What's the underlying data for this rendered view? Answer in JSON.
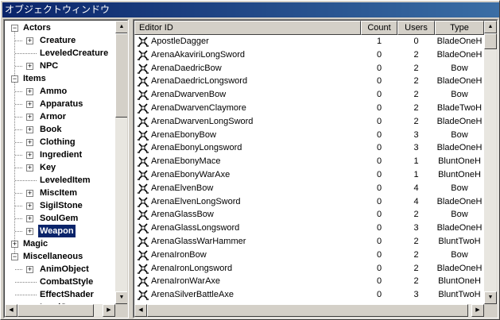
{
  "window": {
    "title": "オブジェクトウィンドウ"
  },
  "tree": {
    "items": [
      {
        "label": "Actors",
        "level": 0,
        "expander": "−",
        "selected": false
      },
      {
        "label": "Creature",
        "level": 1,
        "expander": "+",
        "selected": false
      },
      {
        "label": "LeveledCreature",
        "level": 1,
        "expander": "",
        "selected": false
      },
      {
        "label": "NPC",
        "level": 1,
        "expander": "+",
        "selected": false
      },
      {
        "label": "Items",
        "level": 0,
        "expander": "−",
        "selected": false
      },
      {
        "label": "Ammo",
        "level": 1,
        "expander": "+",
        "selected": false
      },
      {
        "label": "Apparatus",
        "level": 1,
        "expander": "+",
        "selected": false
      },
      {
        "label": "Armor",
        "level": 1,
        "expander": "+",
        "selected": false
      },
      {
        "label": "Book",
        "level": 1,
        "expander": "+",
        "selected": false
      },
      {
        "label": "Clothing",
        "level": 1,
        "expander": "+",
        "selected": false
      },
      {
        "label": "Ingredient",
        "level": 1,
        "expander": "+",
        "selected": false
      },
      {
        "label": "Key",
        "level": 1,
        "expander": "+",
        "selected": false
      },
      {
        "label": "LeveledItem",
        "level": 1,
        "expander": "",
        "selected": false
      },
      {
        "label": "MiscItem",
        "level": 1,
        "expander": "+",
        "selected": false
      },
      {
        "label": "SigilStone",
        "level": 1,
        "expander": "+",
        "selected": false
      },
      {
        "label": "SoulGem",
        "level": 1,
        "expander": "+",
        "selected": false
      },
      {
        "label": "Weapon",
        "level": 1,
        "expander": "+",
        "selected": true
      },
      {
        "label": "Magic",
        "level": 0,
        "expander": "+",
        "selected": false
      },
      {
        "label": "Miscellaneous",
        "level": 0,
        "expander": "−",
        "selected": false
      },
      {
        "label": "AnimObject",
        "level": 1,
        "expander": "+",
        "selected": false
      },
      {
        "label": "CombatStyle",
        "level": 1,
        "expander": "",
        "selected": false
      },
      {
        "label": "EffectShader",
        "level": 1,
        "expander": "",
        "selected": false
      },
      {
        "label": "LoadScreen",
        "level": 1,
        "expander": "",
        "selected": false
      }
    ]
  },
  "list": {
    "columns": {
      "editor_id": "Editor ID",
      "count": "Count",
      "users": "Users",
      "type": "Type"
    },
    "rows": [
      {
        "editor_id": "ApostleDagger",
        "count": "1",
        "users": "0",
        "type": "BladeOneH"
      },
      {
        "editor_id": "ArenaAkaviriLongSword",
        "count": "0",
        "users": "2",
        "type": "BladeOneH"
      },
      {
        "editor_id": "ArenaDaedricBow",
        "count": "0",
        "users": "2",
        "type": "Bow"
      },
      {
        "editor_id": "ArenaDaedricLongsword",
        "count": "0",
        "users": "2",
        "type": "BladeOneH"
      },
      {
        "editor_id": "ArenaDwarvenBow",
        "count": "0",
        "users": "2",
        "type": "Bow"
      },
      {
        "editor_id": "ArenaDwarvenClaymore",
        "count": "0",
        "users": "2",
        "type": "BladeTwoH"
      },
      {
        "editor_id": "ArenaDwarvenLongSword",
        "count": "0",
        "users": "2",
        "type": "BladeOneH"
      },
      {
        "editor_id": "ArenaEbonyBow",
        "count": "0",
        "users": "3",
        "type": "Bow"
      },
      {
        "editor_id": "ArenaEbonyLongsword",
        "count": "0",
        "users": "3",
        "type": "BladeOneH"
      },
      {
        "editor_id": "ArenaEbonyMace",
        "count": "0",
        "users": "1",
        "type": "BluntOneH"
      },
      {
        "editor_id": "ArenaEbonyWarAxe",
        "count": "0",
        "users": "1",
        "type": "BluntOneH"
      },
      {
        "editor_id": "ArenaElvenBow",
        "count": "0",
        "users": "4",
        "type": "Bow"
      },
      {
        "editor_id": "ArenaElvenLongSword",
        "count": "0",
        "users": "4",
        "type": "BladeOneH"
      },
      {
        "editor_id": "ArenaGlassBow",
        "count": "0",
        "users": "2",
        "type": "Bow"
      },
      {
        "editor_id": "ArenaGlassLongsword",
        "count": "0",
        "users": "3",
        "type": "BladeOneH"
      },
      {
        "editor_id": "ArenaGlassWarHammer",
        "count": "0",
        "users": "2",
        "type": "BluntTwoH"
      },
      {
        "editor_id": "ArenaIronBow",
        "count": "0",
        "users": "2",
        "type": "Bow"
      },
      {
        "editor_id": "ArenaIronLongsword",
        "count": "0",
        "users": "2",
        "type": "BladeOneH"
      },
      {
        "editor_id": "ArenaIronWarAxe",
        "count": "0",
        "users": "2",
        "type": "BluntOneH"
      },
      {
        "editor_id": "ArenaSilverBattleAxe",
        "count": "0",
        "users": "3",
        "type": "BluntTwoH"
      }
    ]
  }
}
